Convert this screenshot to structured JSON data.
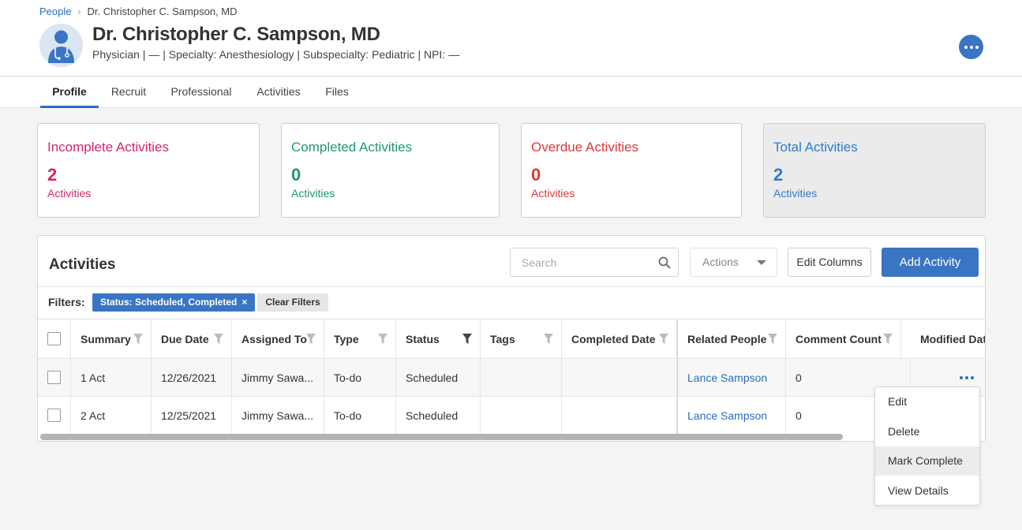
{
  "breadcrumb": {
    "root": "People",
    "current": "Dr. Christopher C. Sampson, MD"
  },
  "person": {
    "name": "Dr. Christopher C. Sampson, MD",
    "meta": "Physician | — | Specialty: Anesthesiology | Subspecialty: Pediatric | NPI: —"
  },
  "tabs": [
    {
      "label": "Profile",
      "active": true
    },
    {
      "label": "Recruit"
    },
    {
      "label": "Professional"
    },
    {
      "label": "Activities"
    },
    {
      "label": "Files"
    }
  ],
  "cards": [
    {
      "title": "Incomplete Activities",
      "count": "2",
      "sub": "Activities",
      "color": "#d6246e"
    },
    {
      "title": "Completed Activities",
      "count": "0",
      "sub": "Activities",
      "color": "#1f9a6b"
    },
    {
      "title": "Overdue Activities",
      "count": "0",
      "sub": "Activities",
      "color": "#d93a3a"
    },
    {
      "title": "Total Activities",
      "count": "2",
      "sub": "Activities",
      "color": "#2b7bd0"
    }
  ],
  "activities": {
    "title": "Activities",
    "search_placeholder": "Search",
    "actions_label": "Actions",
    "edit_columns_label": "Edit Columns",
    "add_label": "Add Activity",
    "filters_label": "Filters:",
    "filter_chip": "Status: Scheduled, Completed",
    "filter_chip_close": "×",
    "clear_filters_label": "Clear Filters",
    "columns": [
      "Summary",
      "Due Date",
      "Assigned To",
      "Type",
      "Status",
      "Tags",
      "Completed Date",
      "Related People",
      "Comment Count",
      "Modified Dat"
    ],
    "rows": [
      {
        "summary": "1 Act",
        "due": "12/26/2021",
        "assigned": "Jimmy Sawa...",
        "type": "To-do",
        "status": "Scheduled",
        "tags": "",
        "completed": "",
        "related": "Lance Sampson",
        "comments": "0",
        "modified": ""
      },
      {
        "summary": "2 Act",
        "due": "12/25/2021",
        "assigned": "Jimmy Sawa...",
        "type": "To-do",
        "status": "Scheduled",
        "tags": "",
        "completed": "",
        "related": "Lance Sampson",
        "comments": "0",
        "modified": ""
      }
    ]
  },
  "row_menu": {
    "items": [
      "Edit",
      "Delete",
      "Mark Complete",
      "View Details"
    ],
    "highlighted": "Mark Complete"
  },
  "colors": {
    "accent": "#3a75c4",
    "link": "#2b6cc4"
  },
  "icons": [
    "avatar-doctor-icon",
    "more-horizontal-icon",
    "search-icon",
    "caret-down-icon",
    "filter-funnel-icon",
    "close-icon",
    "chevron-right-icon"
  ]
}
